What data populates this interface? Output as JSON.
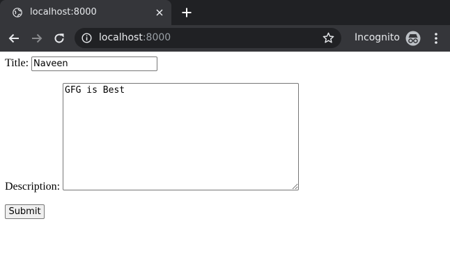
{
  "browser": {
    "tab": {
      "title": "localhost:8000",
      "icon": "globe-icon"
    },
    "new_tab_icon": "plus-icon",
    "address_bar": {
      "host": "localhost",
      "port": ":8000"
    },
    "profile_label": "Incognito"
  },
  "form": {
    "title_label": "Title:",
    "title_value": "Naveen",
    "description_label": "Description:",
    "description_value": "GFG is Best",
    "submit_label": "Submit"
  }
}
